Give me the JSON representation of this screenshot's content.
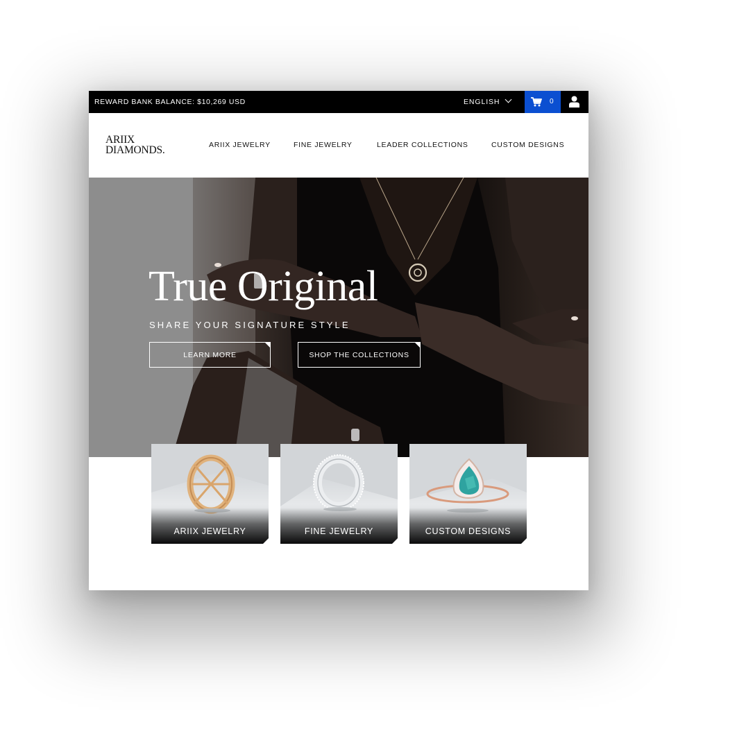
{
  "topbar": {
    "reward_label": "REWARD BANK BALANCE:",
    "reward_value": "$10,269 USD",
    "language": "ENGLISH",
    "cart_count": "0",
    "colors": {
      "background": "#000000",
      "cart": "#0b4fd1"
    }
  },
  "header": {
    "logo_line1": "ARIIX",
    "logo_line2": "DIAMONDS.",
    "nav": [
      {
        "label": "ARIIX JEWELRY"
      },
      {
        "label": "FINE JEWELRY"
      },
      {
        "label": "LEADER COLLECTIONS"
      },
      {
        "label": "CUSTOM DESIGNS"
      }
    ]
  },
  "hero": {
    "title": "True Original",
    "subtitle": "SHARE YOUR SIGNATURE STYLE",
    "buttons": [
      {
        "label": "LEARN MORE"
      },
      {
        "label": "SHOP THE COLLECTIONS"
      }
    ]
  },
  "categories": [
    {
      "label": "ARIIX JEWELRY",
      "icon": "gold-lattice-ring-icon"
    },
    {
      "label": "FINE JEWELRY",
      "icon": "diamond-band-ring-icon"
    },
    {
      "label": "CUSTOM DESIGNS",
      "icon": "turquoise-halo-ring-icon"
    }
  ]
}
